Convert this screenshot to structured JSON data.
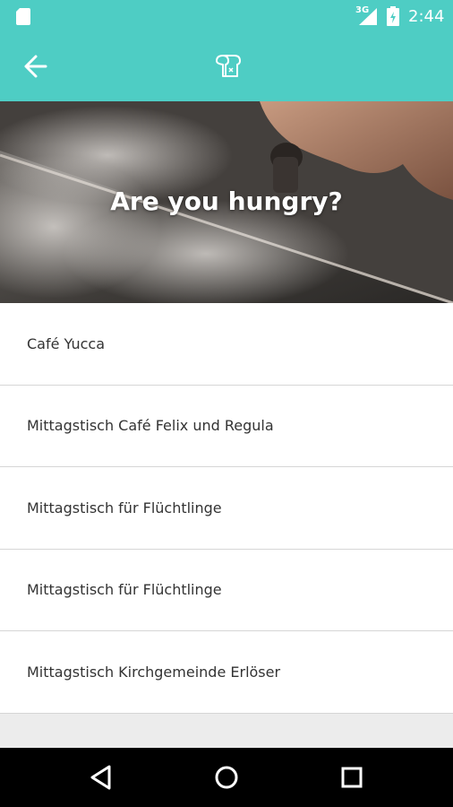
{
  "status_bar": {
    "network_label": "3G",
    "time": "2:44",
    "icons": [
      "sd-card-icon",
      "signal-icon",
      "battery-icon"
    ]
  },
  "app_bar": {
    "back_icon": "arrow-back-icon",
    "logo_icon": "bread-icon",
    "color": "#4ecdc4"
  },
  "hero": {
    "title": "Are you hungry?"
  },
  "list": {
    "items": [
      {
        "label": "Café Yucca"
      },
      {
        "label": "Mittagstisch Café Felix und Regula"
      },
      {
        "label": "Mittagstisch für Flüchtlinge"
      },
      {
        "label": "Mittagstisch für Flüchtlinge"
      },
      {
        "label": "Mittagstisch Kirchgemeinde Erlöser"
      }
    ]
  },
  "nav_bar": {
    "icons": [
      "nav-back-icon",
      "nav-home-icon",
      "nav-recents-icon"
    ]
  }
}
